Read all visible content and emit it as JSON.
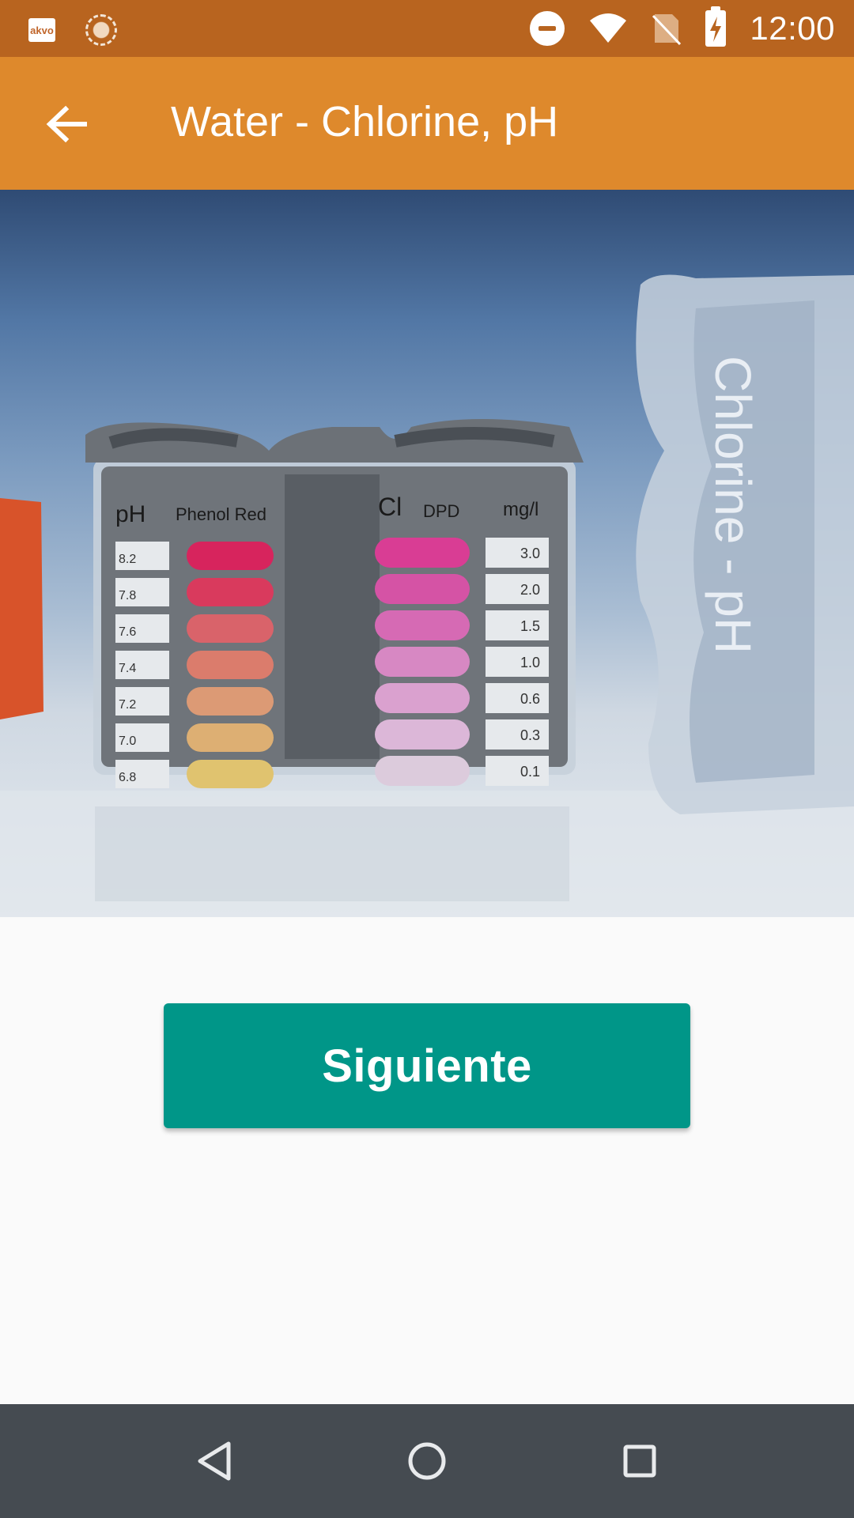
{
  "status_bar": {
    "app_icon_text": "akvo",
    "icons": [
      "akvo-icon",
      "sun-icon",
      "do-not-disturb-icon",
      "wifi-icon",
      "no-sim-icon",
      "battery-charging-icon"
    ],
    "time": "12:00"
  },
  "app_bar": {
    "title": "Water - Chlorine, pH",
    "back_icon": "arrow-left-icon"
  },
  "hero_image": {
    "ph_header": "pH",
    "ph_reagent": "Phenol Red",
    "cl_header": "Cl",
    "cl_reagent": "DPD",
    "cl_unit": "mg/l",
    "ph_values": [
      "8.2",
      "7.8",
      "7.6",
      "7.4",
      "7.2",
      "7.0",
      "6.8"
    ],
    "cl_values": [
      "3.0",
      "2.0",
      "1.5",
      "1.0",
      "0.6",
      "0.3",
      "0.1"
    ],
    "case_label": "Chlorine - pH"
  },
  "actions": {
    "next_label": "Siguiente"
  },
  "nav_bar": {
    "icons": [
      "back-triangle-icon",
      "home-circle-icon",
      "recents-square-icon"
    ]
  },
  "colors": {
    "status_bar": "#b8641f",
    "app_bar": "#de892c",
    "button": "#009688",
    "nav_bar": "#454b51"
  }
}
